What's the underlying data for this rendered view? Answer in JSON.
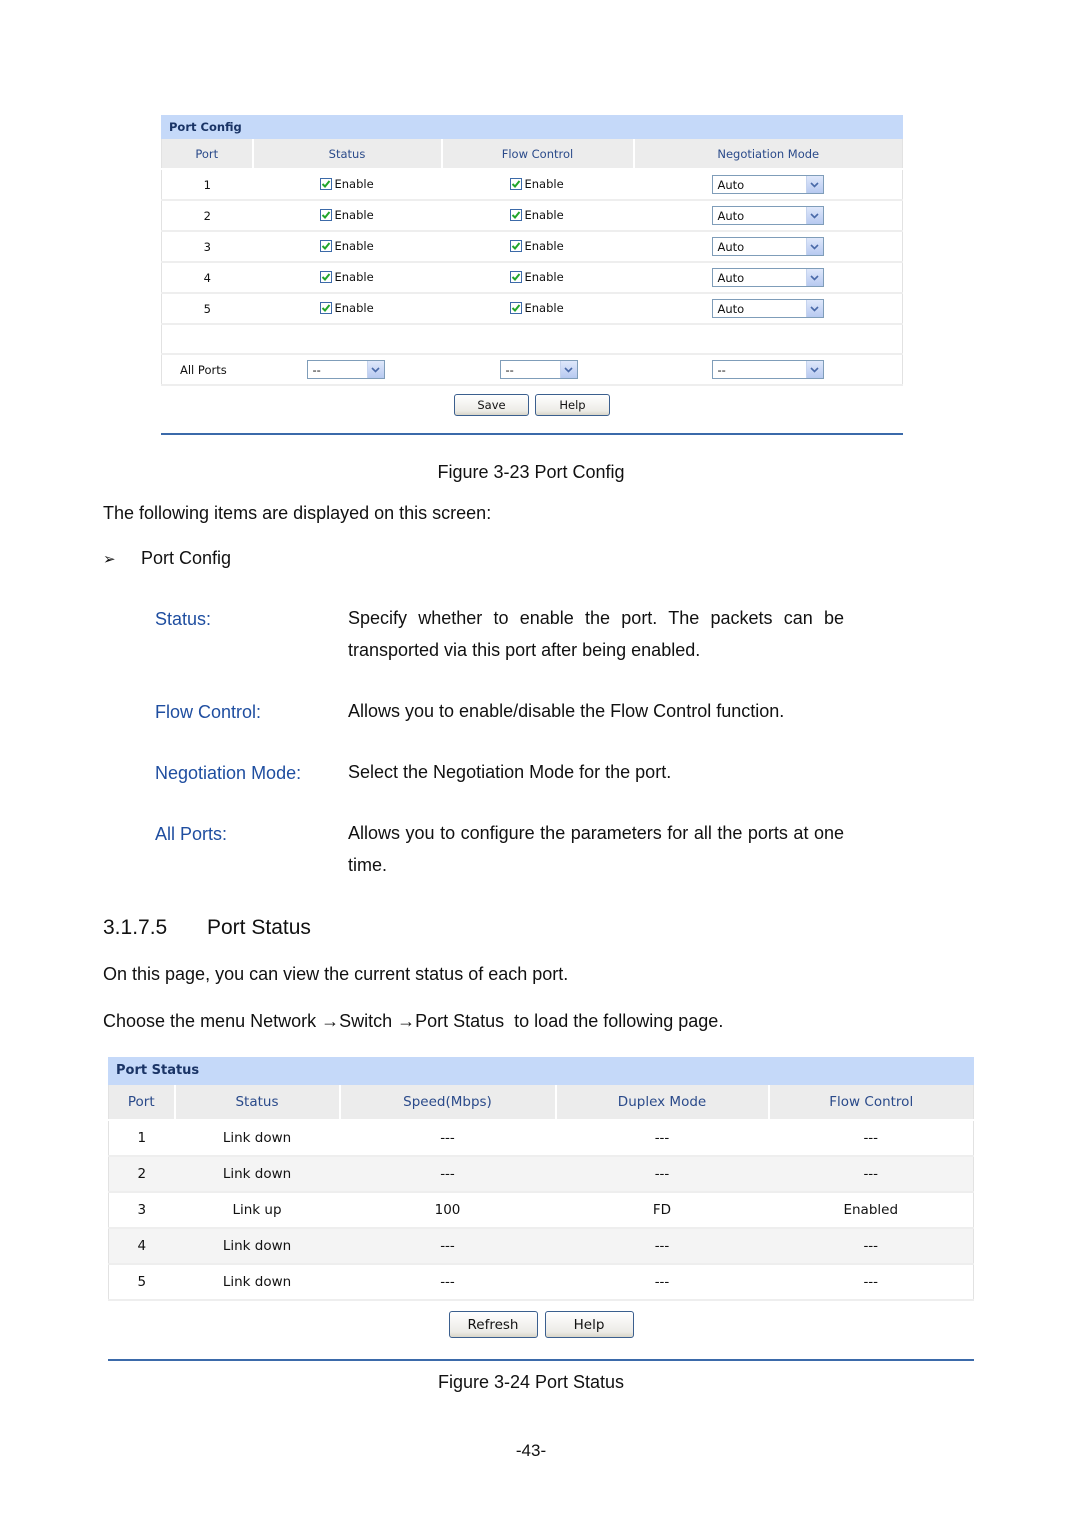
{
  "port_config_panel": {
    "title": "Port Config",
    "columns": [
      "Port",
      "Status",
      "Flow Control",
      "Negotiation Mode"
    ],
    "rows": [
      {
        "port": "1",
        "status": {
          "checked": true,
          "label": "Enable"
        },
        "flow_control": {
          "checked": true,
          "label": "Enable"
        },
        "negotiation_mode": "Auto"
      },
      {
        "port": "2",
        "status": {
          "checked": true,
          "label": "Enable"
        },
        "flow_control": {
          "checked": true,
          "label": "Enable"
        },
        "negotiation_mode": "Auto"
      },
      {
        "port": "3",
        "status": {
          "checked": true,
          "label": "Enable"
        },
        "flow_control": {
          "checked": true,
          "label": "Enable"
        },
        "negotiation_mode": "Auto"
      },
      {
        "port": "4",
        "status": {
          "checked": true,
          "label": "Enable"
        },
        "flow_control": {
          "checked": true,
          "label": "Enable"
        },
        "negotiation_mode": "Auto"
      },
      {
        "port": "5",
        "status": {
          "checked": true,
          "label": "Enable"
        },
        "flow_control": {
          "checked": true,
          "label": "Enable"
        },
        "negotiation_mode": "Auto"
      }
    ],
    "all_ports": {
      "label": "All Ports",
      "status": "--",
      "flow_control": "--",
      "negotiation_mode": "--"
    },
    "buttons": {
      "save": "Save",
      "help": "Help"
    },
    "icons": {
      "checkbox": "checkbox-checked-icon",
      "dropdown": "chevron-down-icon"
    }
  },
  "figure_23_caption": "Figure 3-23 Port Config",
  "intro_text": "The following items are displayed on this screen:",
  "bullet": {
    "icon": "arrow-bullet-icon",
    "glyph": "➢",
    "label": "Port Config"
  },
  "definitions": [
    {
      "term": "Status:",
      "description": "Specify whether to enable the port. The packets can be transported via this port after being enabled."
    },
    {
      "term": "Flow Control:",
      "description": "Allows you to enable/disable the Flow Control function."
    },
    {
      "term": "Negotiation Mode:",
      "description": "Select the Negotiation Mode for the port."
    },
    {
      "term": "All Ports:",
      "description": "Allows you to configure the parameters for all the ports at one time."
    }
  ],
  "section": {
    "number": "3.1.7.5",
    "title": "Port Status"
  },
  "section_text": "On this page, you can view the current status of each port.",
  "menu_path_text": "Choose the menu Network →Switch →Port Status  to load the following page.",
  "port_status_panel": {
    "title": "Port Status",
    "columns": [
      "Port",
      "Status",
      "Speed(Mbps)",
      "Duplex Mode",
      "Flow Control"
    ],
    "rows": [
      {
        "port": "1",
        "status": "Link down",
        "speed": "---",
        "duplex": "---",
        "flow_control": "---"
      },
      {
        "port": "2",
        "status": "Link down",
        "speed": "---",
        "duplex": "---",
        "flow_control": "---"
      },
      {
        "port": "3",
        "status": "Link up",
        "speed": "100",
        "duplex": "FD",
        "flow_control": "Enabled"
      },
      {
        "port": "4",
        "status": "Link down",
        "speed": "---",
        "duplex": "---",
        "flow_control": "---"
      },
      {
        "port": "5",
        "status": "Link down",
        "speed": "---",
        "duplex": "---",
        "flow_control": "---"
      }
    ],
    "buttons": {
      "refresh": "Refresh",
      "help": "Help"
    }
  },
  "figure_24_caption": "Figure 3-24 Port Status",
  "page_number": "-43-",
  "colors": {
    "term_blue": "#1f4ea0",
    "panel_title_bg": "#c5d9f9",
    "panel_header_text": "#2a4a8a",
    "check_green": "#22a52a"
  }
}
